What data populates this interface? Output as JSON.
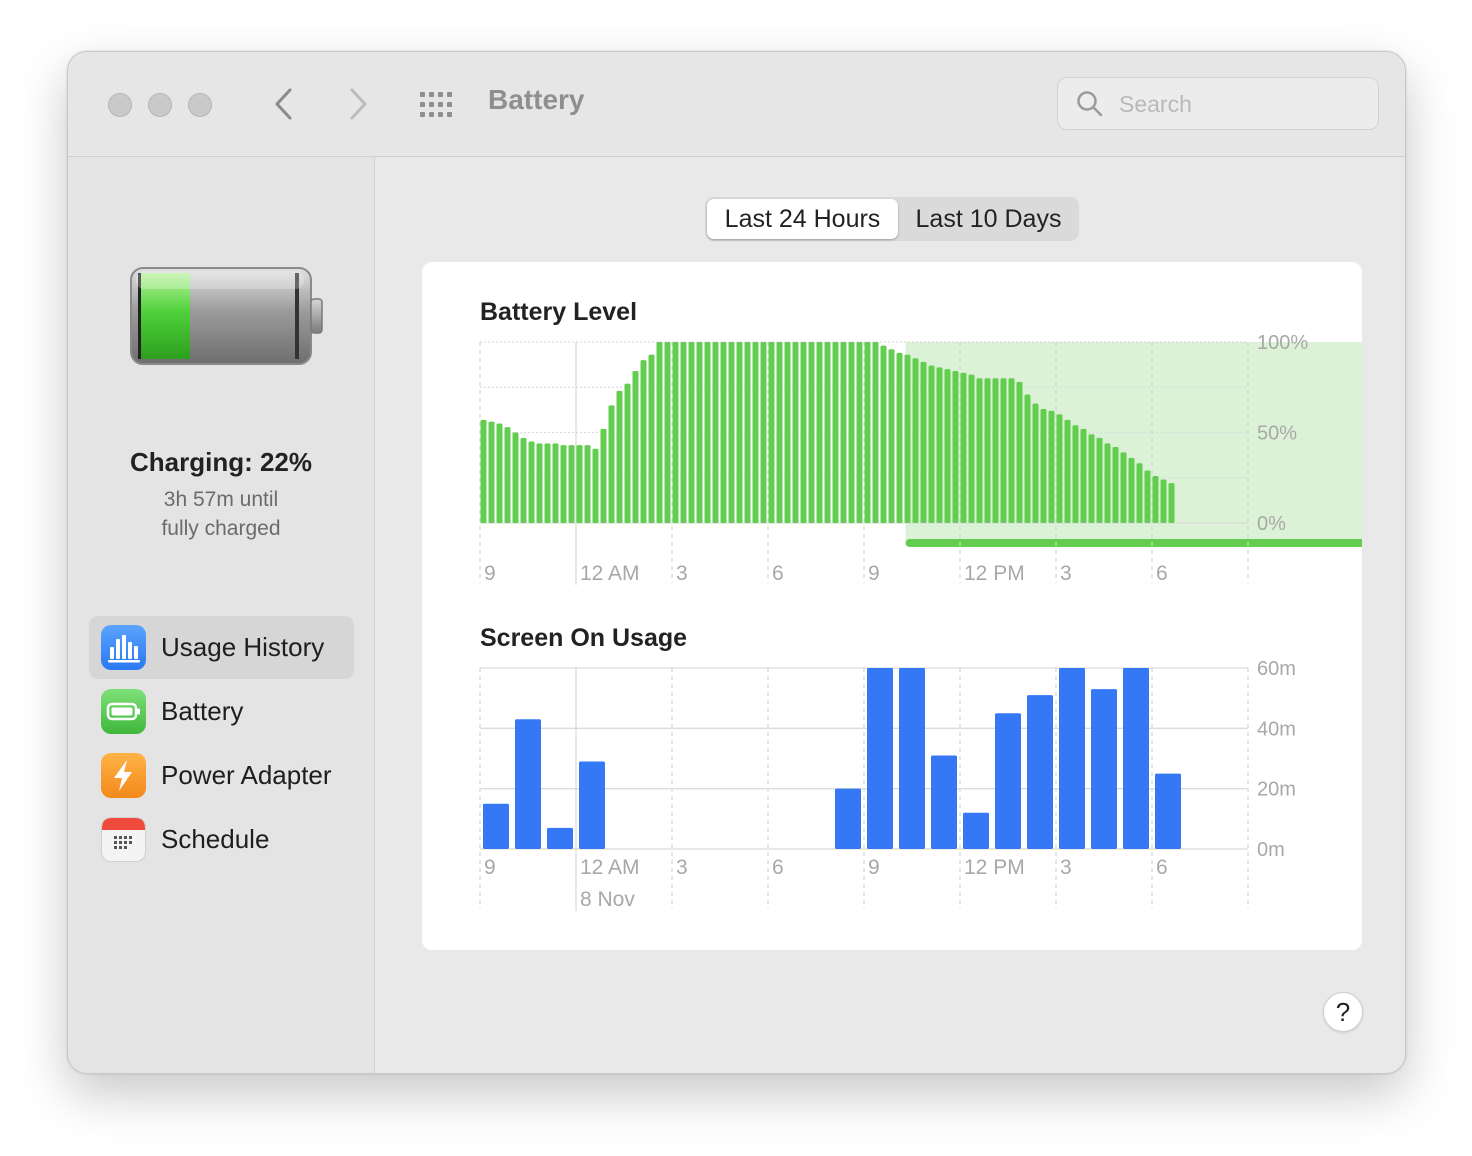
{
  "window": {
    "title": "Battery"
  },
  "search": {
    "placeholder": "Search"
  },
  "status": {
    "title": "Charging: 22%",
    "line1": "3h 57m until",
    "line2": "fully charged"
  },
  "sidebar": {
    "items": [
      {
        "label": "Usage History",
        "icon": "usage-history-icon",
        "selected": true
      },
      {
        "label": "Battery",
        "icon": "battery-icon"
      },
      {
        "label": "Power Adapter",
        "icon": "power-adapter-icon"
      },
      {
        "label": "Schedule",
        "icon": "schedule-icon"
      }
    ]
  },
  "segment": {
    "options": [
      "Last 24 Hours",
      "Last 10 Days"
    ],
    "selected": "Last 24 Hours"
  },
  "help": {
    "label": "?"
  },
  "colors": {
    "battery_bar": "#62cd4f",
    "charging_band": "#dcf2d6",
    "usage_bar": "#3478f6"
  },
  "chart_data": [
    {
      "type": "bar",
      "title": "Battery Level",
      "y_ticks": [
        "100%",
        "50%",
        "0%"
      ],
      "ylim": [
        0,
        100
      ],
      "x_tick_labels": [
        "9",
        "12 AM",
        "3",
        "6",
        "9",
        "12 PM",
        "3",
        "6"
      ],
      "charging_intervals": [
        [
          13.3,
          43.6
        ]
      ],
      "values": [
        57,
        56,
        55,
        53,
        50,
        47,
        45,
        44,
        44,
        44,
        43,
        43,
        43,
        43,
        41,
        52,
        65,
        73,
        77,
        84,
        90,
        93,
        100,
        100,
        100,
        100,
        100,
        100,
        100,
        100,
        100,
        100,
        100,
        100,
        100,
        100,
        100,
        100,
        100,
        100,
        100,
        100,
        100,
        100,
        100,
        100,
        100,
        100,
        100,
        100,
        98,
        96,
        94,
        93,
        91,
        89,
        87,
        86,
        85,
        84,
        83,
        82,
        80,
        80,
        80,
        80,
        80,
        78,
        71,
        66,
        63,
        62,
        60,
        57,
        54,
        52,
        49,
        47,
        44,
        42,
        39,
        36,
        33,
        29,
        26,
        24,
        22
      ]
    },
    {
      "type": "bar",
      "title": "Screen On Usage",
      "y_ticks": [
        "60m",
        "40m",
        "20m",
        "0m"
      ],
      "ylim": [
        0,
        60
      ],
      "x_tick_labels": [
        "9",
        "12 AM",
        "3",
        "6",
        "9",
        "12 PM",
        "3",
        "6"
      ],
      "date_label": "8 Nov",
      "values": [
        15,
        43,
        7,
        29,
        0,
        0,
        0,
        0,
        0,
        0,
        0,
        20,
        60,
        60,
        31,
        12,
        45,
        51,
        60,
        53,
        60,
        25
      ]
    }
  ]
}
